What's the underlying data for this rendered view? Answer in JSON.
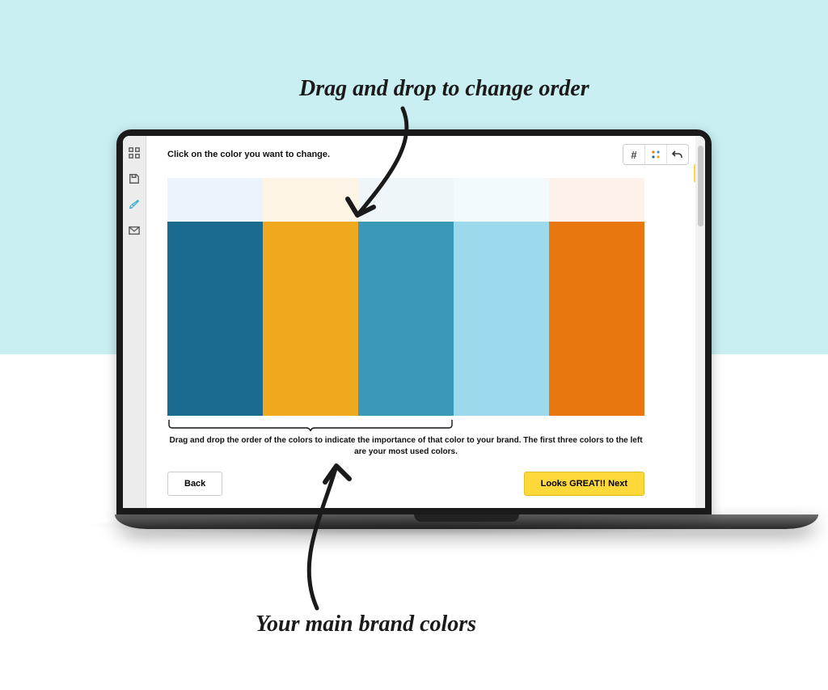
{
  "annotations": {
    "top": "Drag and drop to change order",
    "bottom": "Your main brand colors"
  },
  "sidebar": {
    "icons": [
      "grid-icon",
      "save-icon",
      "brush-icon",
      "mail-icon"
    ]
  },
  "dialog": {
    "instruction": "Click on the color you want to change.",
    "help_text": "Drag and drop the order of the colors to indicate the importance of that color to your brand. The first three colors to the left are your most used colors.",
    "back_label": "Back",
    "next_label": "Looks GREAT!! Next"
  },
  "toolbar": {
    "hash_label": "#"
  },
  "palette": {
    "preview": [
      "#eaf4fa",
      "#fdf4e6",
      "#eef6f9",
      "#f3fafe",
      "#fdf1ea"
    ],
    "colors": [
      "#1b6b91",
      "#f0a81f",
      "#3b98b9",
      "#9cd9ed",
      "#e9770f"
    ]
  }
}
